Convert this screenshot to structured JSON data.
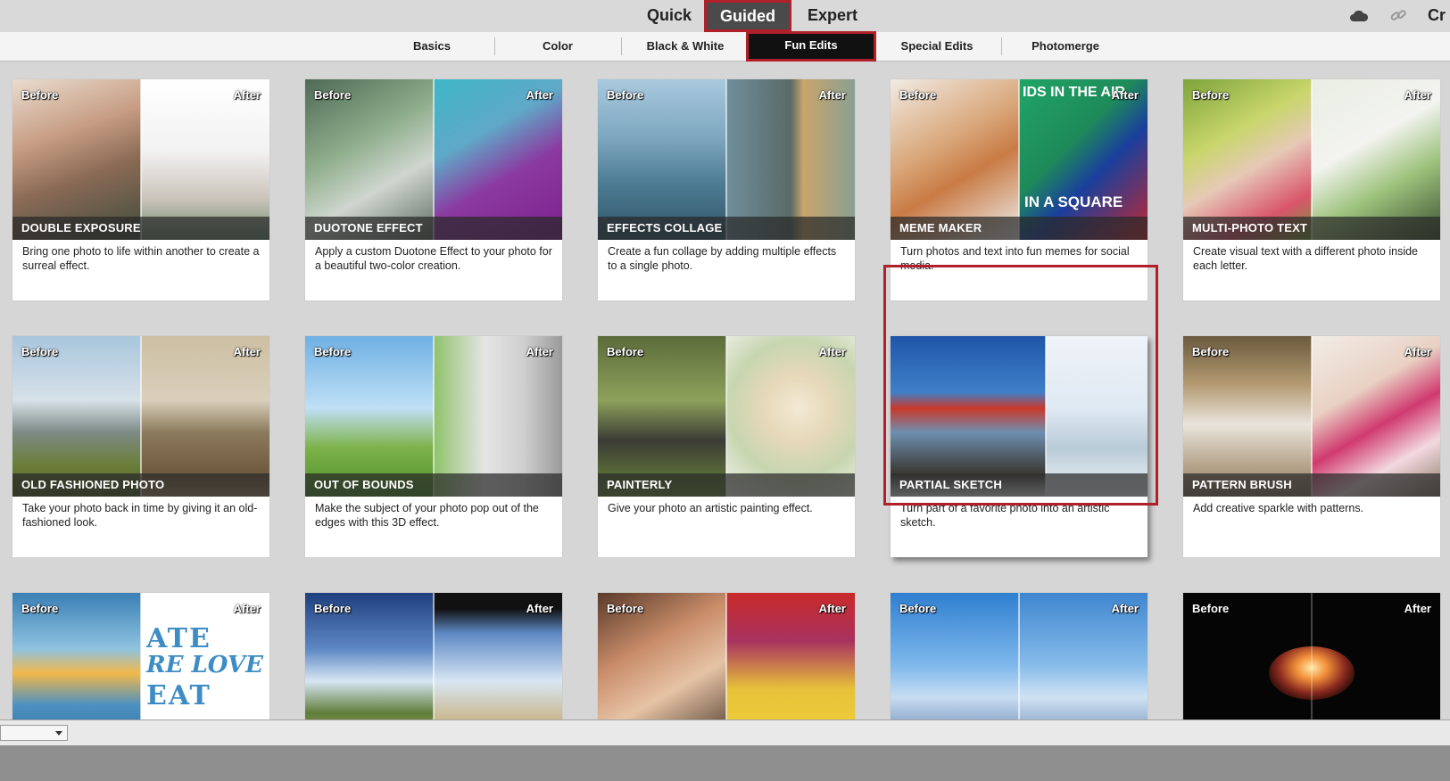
{
  "modes": {
    "quick": "Quick",
    "guided": "Guided",
    "expert": "Expert",
    "create_partial": "Cr"
  },
  "top_icons": [
    "cloud-icon",
    "link-icon"
  ],
  "subtabs": [
    "Basics",
    "Color",
    "Black & White",
    "Fun Edits",
    "Special Edits",
    "Photomerge"
  ],
  "active_subtab": "Fun Edits",
  "labels": {
    "before": "Before",
    "after": "After"
  },
  "cards": [
    {
      "title": "DOUBLE EXPOSURE",
      "desc": "Bring one photo to life within another to create a surreal effect."
    },
    {
      "title": "DUOTONE EFFECT",
      "desc": "Apply a custom Duotone Effect to your photo for a beautiful two-color creation."
    },
    {
      "title": "EFFECTS COLLAGE",
      "desc": "Create a fun collage by adding multiple effects to a single photo."
    },
    {
      "title": "MEME MAKER",
      "desc": "Turn photos and text into fun memes for social media.",
      "after_text_top": "IDS IN THE AIR",
      "after_text_bottom": "IN A SQUARE"
    },
    {
      "title": "MULTI-PHOTO TEXT",
      "desc": "Create visual text with a different photo inside each letter."
    },
    {
      "title": "OLD FASHIONED PHOTO",
      "desc": "Take your photo back in time by giving it an old-fashioned look."
    },
    {
      "title": "OUT OF BOUNDS",
      "desc": "Make the subject of your photo pop out of the edges with this 3D effect."
    },
    {
      "title": "PAINTERLY",
      "desc": "Give your photo an artistic painting effect."
    },
    {
      "title": "PARTIAL SKETCH",
      "desc": "Turn part of a favorite photo into an artistic sketch.",
      "selected": true
    },
    {
      "title": "PATTERN BRUSH",
      "desc": "Add creative sparkle with patterns."
    },
    {
      "title": "",
      "desc": "",
      "after_text": [
        "ATE",
        "RE LOVE",
        "EAT"
      ]
    },
    {
      "title": "",
      "desc": ""
    },
    {
      "title": "",
      "desc": ""
    },
    {
      "title": "",
      "desc": ""
    },
    {
      "title": "",
      "desc": ""
    }
  ]
}
